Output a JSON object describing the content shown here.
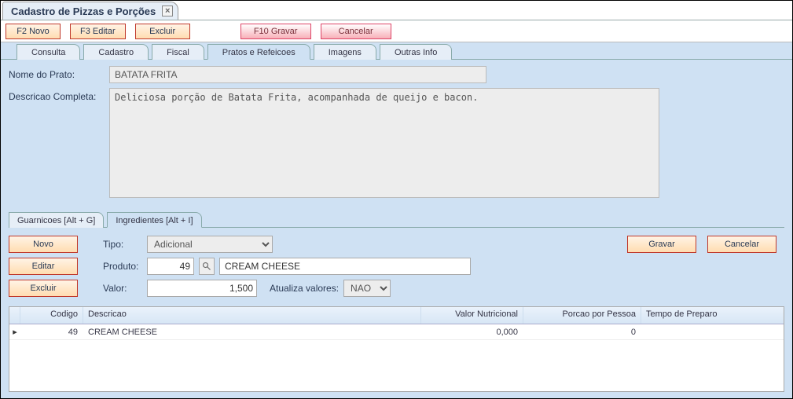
{
  "window": {
    "title": "Cadastro de Pizzas e Porções"
  },
  "toolbar": {
    "novo": "F2 Novo",
    "editar": "F3 Editar",
    "excluir": "Excluir",
    "gravar": "F10 Gravar",
    "cancelar": "Cancelar"
  },
  "tabs": {
    "consulta": "Consulta",
    "cadastro": "Cadastro",
    "fiscal": "Fiscal",
    "pratos": "Pratos e Refeicoes",
    "imagens": "Imagens",
    "outras": "Outras Info"
  },
  "form": {
    "nome_label": "Nome do Prato:",
    "nome_value": "BATATA FRITA",
    "descricao_label": "Descricao Completa:",
    "descricao_value": "Deliciosa porção de Batata Frita, acompanhada de queijo e bacon."
  },
  "subtabs": {
    "guarnicoes": "Guarnicoes [Alt + G]",
    "ingredientes": "Ingredientes [Alt + I]"
  },
  "sub_buttons": {
    "novo": "Novo",
    "editar": "Editar",
    "excluir": "Excluir",
    "gravar": "Gravar",
    "cancelar": "Cancelar"
  },
  "sub_form": {
    "tipo_label": "Tipo:",
    "tipo_value": "Adicional",
    "produto_label": "Produto:",
    "produto_code": "49",
    "produto_name": "CREAM CHEESE",
    "valor_label": "Valor:",
    "valor_value": "1,500",
    "atualiza_label": "Atualiza valores:",
    "atualiza_value": "NAO"
  },
  "grid": {
    "headers": {
      "codigo": "Codigo",
      "descricao": "Descricao",
      "valor_nutricional": "Valor Nutricional",
      "porcao": "Porcao por Pessoa",
      "tempo": "Tempo de Preparo"
    },
    "rows": [
      {
        "codigo": "49",
        "descricao": "CREAM CHEESE",
        "valor_nutricional": "0,000",
        "porcao": "0",
        "tempo": ""
      }
    ]
  }
}
